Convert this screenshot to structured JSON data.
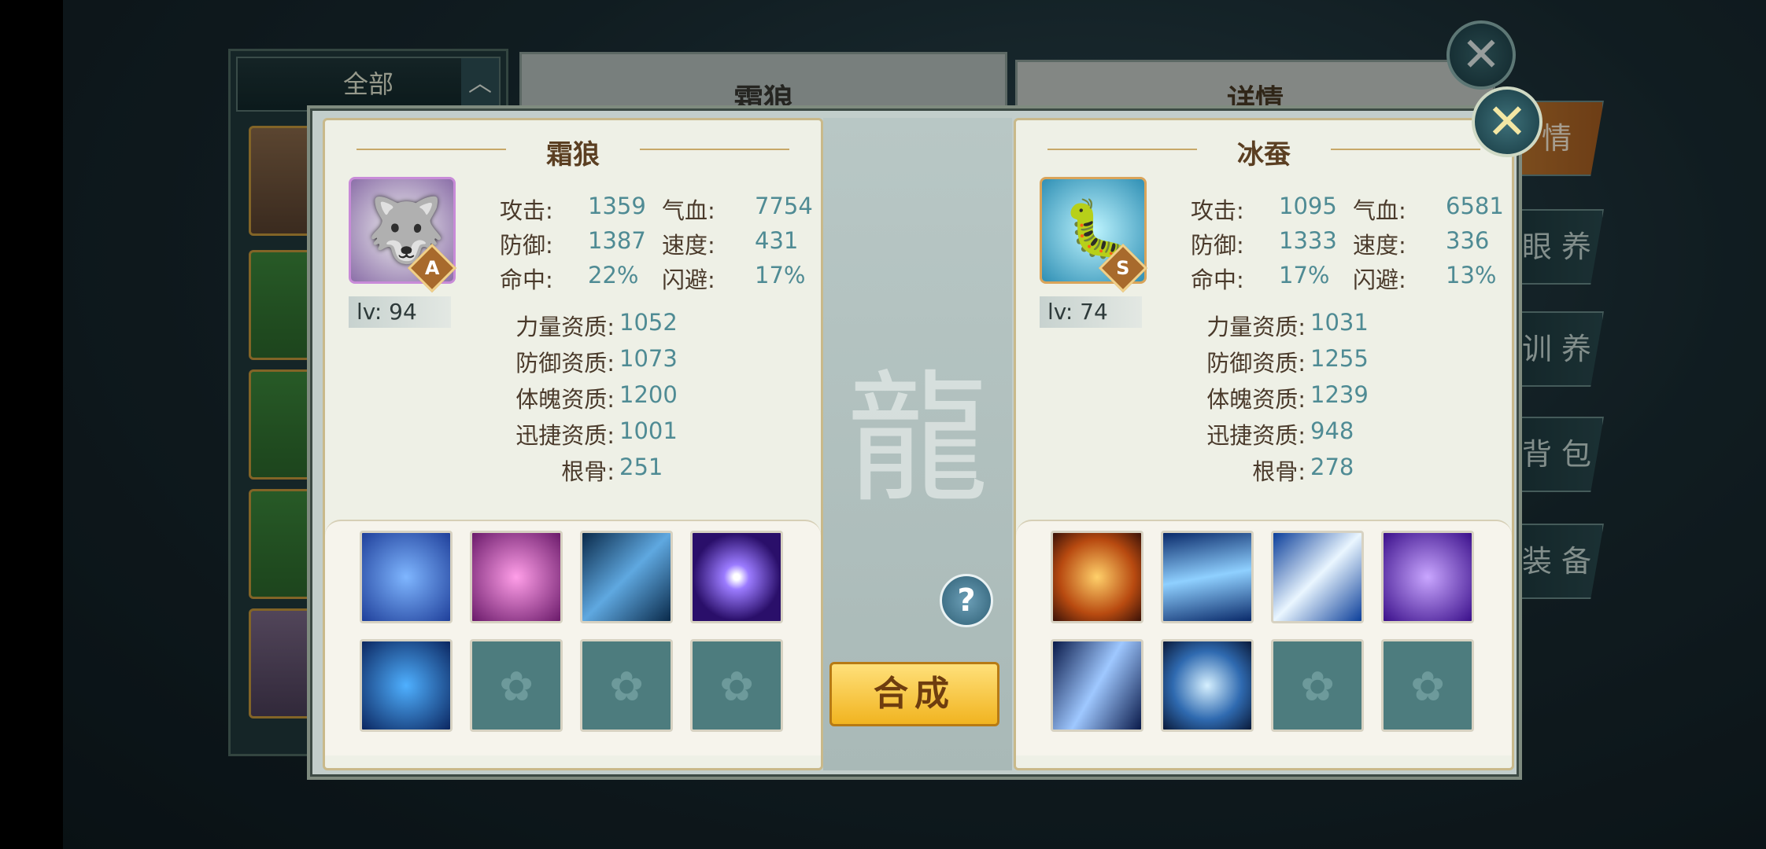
{
  "background": {
    "filter_label": "全部",
    "main_title": "霜狼",
    "detail_title": "详情",
    "side_tabs": [
      "情",
      "眼 养",
      "训 养",
      "背 包",
      "装 备"
    ]
  },
  "left_pet": {
    "name": "霜狼",
    "grade": "A",
    "level": "lv: 94",
    "stats": [
      {
        "l1": "攻击:",
        "v1": "1359",
        "l2": "气血:",
        "v2": "7754"
      },
      {
        "l1": "防御:",
        "v1": "1387",
        "l2": "速度:",
        "v2": "431"
      },
      {
        "l1": "命中:",
        "v1": "22%",
        "l2": "闪避:",
        "v2": "17%"
      }
    ],
    "aptitudes": [
      {
        "label": "力量资质:",
        "value": "1052"
      },
      {
        "label": "防御资质:",
        "value": "1073"
      },
      {
        "label": "体魄资质:",
        "value": "1200"
      },
      {
        "label": "迅捷资质:",
        "value": "1001"
      },
      {
        "label": "根骨:",
        "value": "251"
      }
    ],
    "skills": [
      "shield-skill-icon",
      "heart-skill-icon",
      "ice-spike-skill-icon",
      "orb-skill-icon",
      "vortex-skill-icon",
      "empty",
      "empty",
      "empty"
    ]
  },
  "right_pet": {
    "name": "冰蚕",
    "grade": "S",
    "level": "lv: 74",
    "stats": [
      {
        "l1": "攻击:",
        "v1": "1095",
        "l2": "气血:",
        "v2": "6581"
      },
      {
        "l1": "防御:",
        "v1": "1333",
        "l2": "速度:",
        "v2": "336"
      },
      {
        "l1": "命中:",
        "v1": "17%",
        "l2": "闪避:",
        "v2": "13%"
      }
    ],
    "aptitudes": [
      {
        "label": "力量资质:",
        "value": "1031"
      },
      {
        "label": "防御资质:",
        "value": "1255"
      },
      {
        "label": "体魄资质:",
        "value": "1239"
      },
      {
        "label": "迅捷资质:",
        "value": "948"
      },
      {
        "label": "根骨:",
        "value": "278"
      }
    ],
    "skills": [
      "phoenix-skill-icon",
      "wind-skill-icon",
      "lightning-skill-icon",
      "purple-vortex-skill-icon",
      "claw-skill-icon",
      "blue-heart-skill-icon",
      "empty",
      "empty"
    ]
  },
  "center": {
    "help_label": "?",
    "combine_label": "合成"
  },
  "colors": {
    "accent_gold": "#f1b420",
    "stat_value": "#4f8b94",
    "panel_bg": "#eef0e6"
  }
}
